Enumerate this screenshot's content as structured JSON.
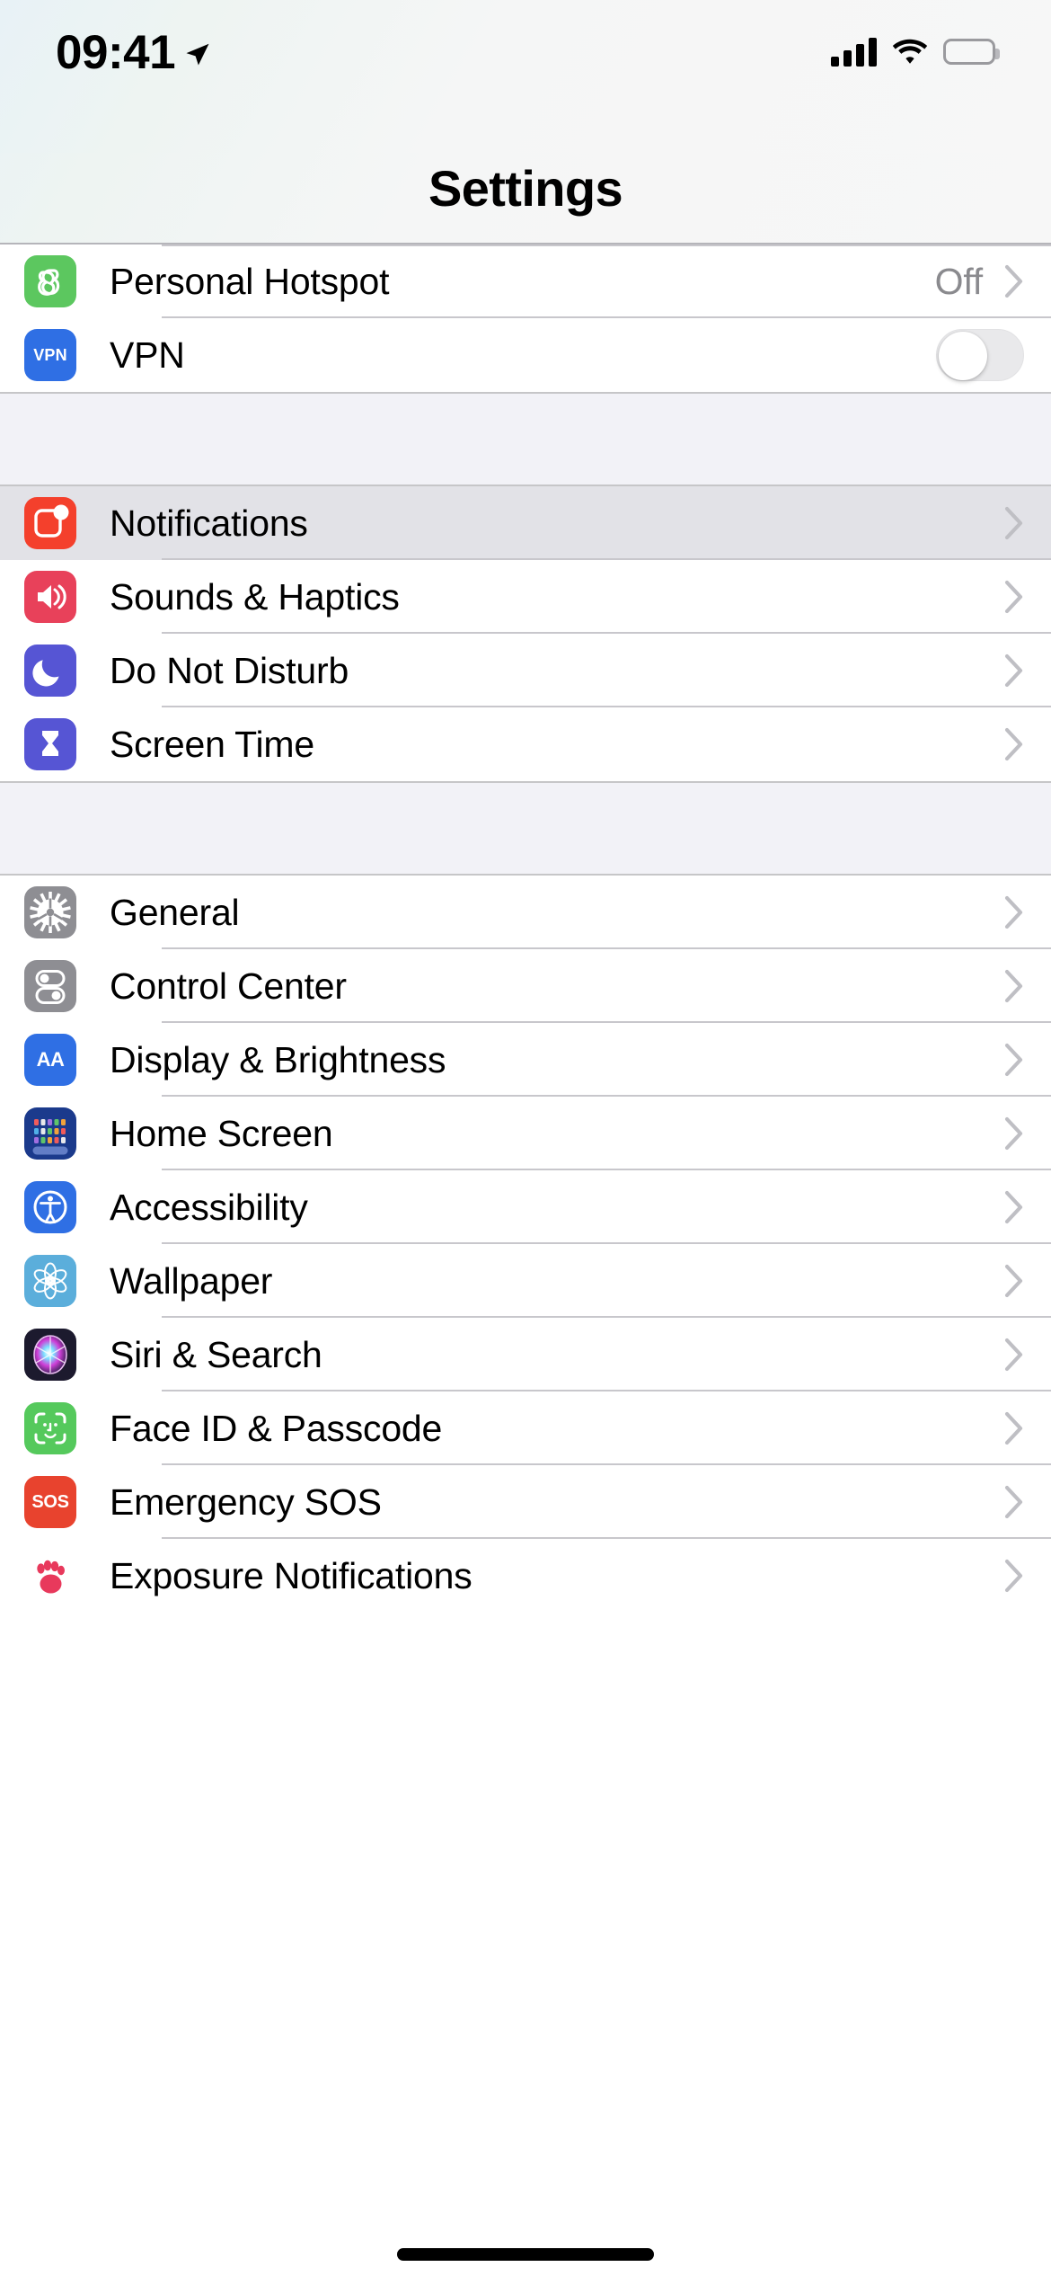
{
  "status_bar": {
    "time": "09:41",
    "location_icon": "location-arrow-icon",
    "cellular_icon": "cellular-signal-icon",
    "wifi_icon": "wifi-icon",
    "battery_icon": "battery-full-icon"
  },
  "header": {
    "title": "Settings"
  },
  "colors": {
    "hotspot_green": "#5CC75F",
    "vpn_blue": "#2F6FE4",
    "notifications_red": "#F4402C",
    "sounds_pink": "#E8415A",
    "dnd_indigo": "#5655D4",
    "screentime_indigo": "#5655D4",
    "general_gray": "#8E8E93",
    "control_gray": "#8E8E93",
    "display_blue": "#2F6FE4",
    "homescreen_navy": "#1B3A8C",
    "accessibility_blue": "#2F6FE4",
    "wallpaper_skyblue": "#5BAEDB",
    "siri_dark": "#1C1A2E",
    "faceid_green": "#55C95C",
    "sos_red": "#E8432E",
    "exposure_pink": "#E8395C",
    "selected_row_bg": "#E2E2E7",
    "section_gap_bg": "#F2F2F7",
    "value_text_gray": "#8A8A8E",
    "divider_gray": "#C8C7CC"
  },
  "sections": [
    {
      "id": "connectivity",
      "rows": [
        {
          "id": "personal-hotspot",
          "label": "Personal Hotspot",
          "icon": "personal-hotspot-icon",
          "value": "Off",
          "accessory": "chevron",
          "selected": false
        },
        {
          "id": "vpn",
          "label": "VPN",
          "icon": "vpn-icon",
          "icon_text": "VPN",
          "value": "",
          "accessory": "toggle",
          "toggle_on": false,
          "selected": false
        }
      ]
    },
    {
      "id": "alerts",
      "rows": [
        {
          "id": "notifications",
          "label": "Notifications",
          "icon": "notifications-icon",
          "value": "",
          "accessory": "chevron",
          "selected": true
        },
        {
          "id": "sounds-haptics",
          "label": "Sounds & Haptics",
          "icon": "sounds-haptics-icon",
          "value": "",
          "accessory": "chevron",
          "selected": false
        },
        {
          "id": "do-not-disturb",
          "label": "Do Not Disturb",
          "icon": "do-not-disturb-icon",
          "value": "",
          "accessory": "chevron",
          "selected": false
        },
        {
          "id": "screen-time",
          "label": "Screen Time",
          "icon": "screen-time-icon",
          "value": "",
          "accessory": "chevron",
          "selected": false
        }
      ]
    },
    {
      "id": "system",
      "rows": [
        {
          "id": "general",
          "label": "General",
          "icon": "general-gear-icon",
          "value": "",
          "accessory": "chevron",
          "selected": false
        },
        {
          "id": "control-center",
          "label": "Control Center",
          "icon": "control-center-icon",
          "value": "",
          "accessory": "chevron",
          "selected": false
        },
        {
          "id": "display-brightness",
          "label": "Display & Brightness",
          "icon": "display-brightness-icon",
          "icon_text": "AA",
          "value": "",
          "accessory": "chevron",
          "selected": false
        },
        {
          "id": "home-screen",
          "label": "Home Screen",
          "icon": "home-screen-icon",
          "value": "",
          "accessory": "chevron",
          "selected": false
        },
        {
          "id": "accessibility",
          "label": "Accessibility",
          "icon": "accessibility-icon",
          "value": "",
          "accessory": "chevron",
          "selected": false
        },
        {
          "id": "wallpaper",
          "label": "Wallpaper",
          "icon": "wallpaper-icon",
          "value": "",
          "accessory": "chevron",
          "selected": false
        },
        {
          "id": "siri-search",
          "label": "Siri & Search",
          "icon": "siri-icon",
          "value": "",
          "accessory": "chevron",
          "selected": false
        },
        {
          "id": "face-id-passcode",
          "label": "Face ID & Passcode",
          "icon": "face-id-icon",
          "value": "",
          "accessory": "chevron",
          "selected": false
        },
        {
          "id": "emergency-sos",
          "label": "Emergency SOS",
          "icon": "emergency-sos-icon",
          "icon_text": "SOS",
          "value": "",
          "accessory": "chevron",
          "selected": false
        },
        {
          "id": "exposure-notifications",
          "label": "Exposure Notifications",
          "icon": "exposure-notifications-icon",
          "value": "",
          "accessory": "chevron",
          "selected": false
        }
      ]
    }
  ],
  "home_indicator": "home-indicator"
}
